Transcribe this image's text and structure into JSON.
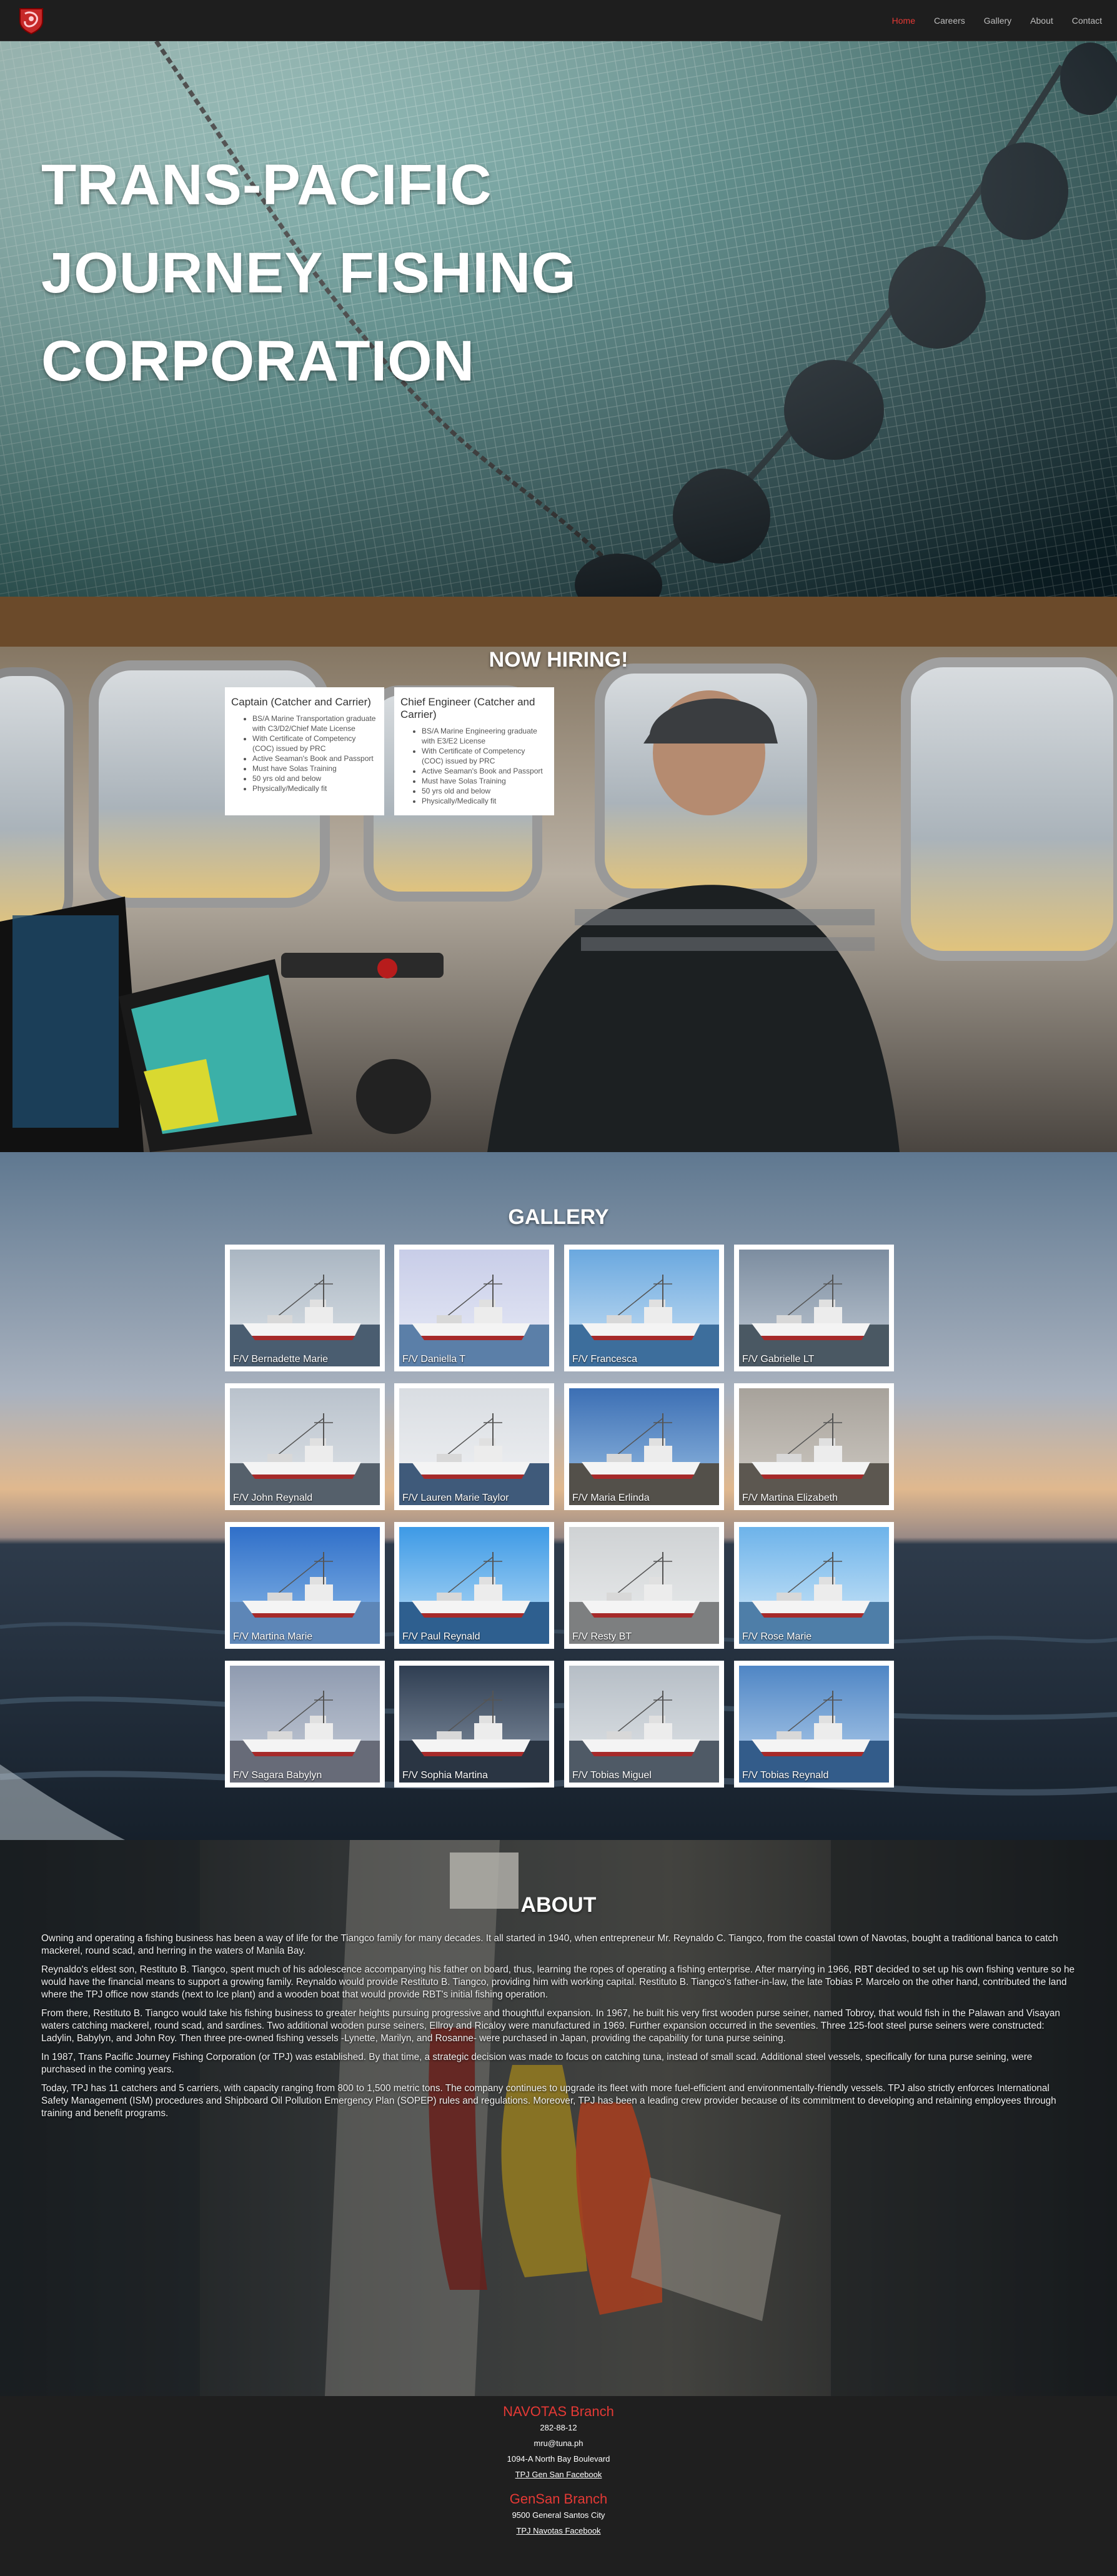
{
  "nav": {
    "logo_alt": "TPJ logo",
    "links": [
      {
        "label": "Home",
        "active": true
      },
      {
        "label": "Careers",
        "active": false
      },
      {
        "label": "Gallery",
        "active": false
      },
      {
        "label": "About",
        "active": false
      },
      {
        "label": "Contact",
        "active": false
      }
    ]
  },
  "hero": {
    "title_lines": [
      "TRANS-PACIFIC",
      "JOURNEY FISHING",
      "CORPORATION"
    ]
  },
  "hiring": {
    "title": "NOW HIRING!",
    "cards": [
      {
        "title": "Captain (Catcher and Carrier)",
        "items": [
          "BS/A Marine Transportation graduate with C3/D2/Chief Mate License",
          "With Certificate of Competency (COC) issued by PRC",
          "Active Seaman's Book and Passport",
          "Must have Solas Training",
          "50 yrs old and below",
          "Physically/Medically fit"
        ]
      },
      {
        "title": "Chief Engineer (Catcher and Carrier)",
        "items": [
          "BS/A Marine Engineering graduate with E3/E2 License",
          "With Certificate of Competency (COC) issued by PRC",
          "Active Seaman's Book and Passport",
          "Must have Solas Training",
          "50 yrs old and below",
          "Physically/Medically fit"
        ]
      }
    ]
  },
  "gallery": {
    "title": "GALLERY",
    "items": [
      "F/V Bernadette Marie",
      "F/V Daniella T",
      "F/V Francesca",
      "F/V Gabrielle LT",
      "F/V John Reynald",
      "F/V Lauren Marie Taylor",
      "F/V Maria Erlinda",
      "F/V Martina Elizabeth",
      "F/V Martina Marie",
      "F/V Paul Reynald",
      "F/V Resty BT",
      "F/V Rose Marie",
      "F/V Sagara Babylyn",
      "F/V Sophia Martina",
      "F/V Tobias Miguel",
      "F/V Tobias Reynald"
    ]
  },
  "about": {
    "title": "ABOUT",
    "paragraphs": [
      "Owning and operating a fishing business has been a way of life for the Tiangco family for many decades. It all started in 1940, when entrepreneur Mr. Reynaldo C. Tiangco, from the coastal town of Navotas, bought a traditional banca to catch mackerel, round scad, and herring in the waters of Manila Bay.",
      "Reynaldo's eldest son, Restituto B. Tiangco, spent much of his adolescence accompanying his father on board, thus, learning the ropes of operating a fishing enterprise. After marrying in 1966, RBT decided to set up his own fishing venture so he would have the financial means to support a growing family. Reynaldo would provide Restituto B. Tiangco, providing him with working capital. Restituto B. Tiangco's father-in-law, the late Tobias P. Marcelo on the other hand, contributed the land where the TPJ office now stands (next to Ice plant) and a wooden boat that would provide RBT's initial fishing operation.",
      "From there, Restituto B. Tiangco would take his fishing business to greater heights pursuing progressive and thoughtful expansion. In 1967, he built his very first wooden purse seiner, named Tobroy, that would fish in the Palawan and Visayan waters catching mackerel, round scad, and sardines. Two additional wooden purse seiners, Ellroy and Ricaloy were manufactured in 1969. Further expansion occurred in the seventies. Three 125-foot steel purse seiners were constructed: Ladylin, Babylyn, and John Roy. Then three pre-owned fishing vessels -Lynette, Marilyn, and Rosanne- were purchased in Japan, providing the capability for tuna purse seining.",
      "In 1987, Trans Pacific Journey Fishing Corporation (or TPJ) was established. By that time, a strategic decision was made to focus on catching tuna, instead of small scad. Additional steel vessels, specifically for tuna purse seining, were purchased in the coming years.",
      "Today, TPJ has 11 catchers and 5 carriers, with capacity ranging from 800 to 1,500 metric tons. The company continues to upgrade its fleet with more fuel-efficient and environmentally-friendly vessels. TPJ also strictly enforces International Safety Management (ISM) procedures and Shipboard Oil Pollution Emergency Plan (SOPEP) rules and regulations. Moreover, TPJ has been a leading crew provider because of its commitment to developing and retaining employees through training and benefit programs."
    ]
  },
  "footer": {
    "branches": [
      {
        "name": "NAVOTAS Branch",
        "phone": "282-88-12",
        "email": "mru@tuna.ph",
        "address": "1094-A North Bay Boulevard",
        "link": "TPJ Gen San Facebook"
      },
      {
        "name": "GenSan Branch",
        "address": "9500 General Santos City",
        "link": "TPJ Navotas Facebook"
      }
    ]
  },
  "colors": {
    "accent": "#e53935",
    "nav_bg": "#1e1e1e",
    "footer_bg": "#1f1f1f"
  }
}
